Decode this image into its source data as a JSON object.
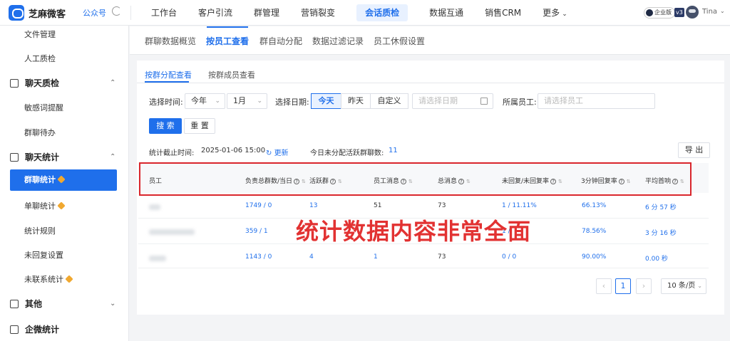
{
  "header": {
    "brand": "芝麻微客",
    "brand_sub": "公众号",
    "nav": [
      "工作台",
      "客户引流",
      "群管理",
      "营销裂变",
      "会话质检",
      "数据互通",
      "销售CRM",
      "更多"
    ],
    "nav_active_index": 4,
    "enterprise_badge": "企业版",
    "version_badge": "v3",
    "user_name": "Tina"
  },
  "sidebar": {
    "items": [
      {
        "label": "文件管理",
        "type": "item"
      },
      {
        "label": "人工质检",
        "type": "item"
      },
      {
        "label": "聊天质检",
        "type": "group"
      },
      {
        "label": "敏感词提醒",
        "type": "item"
      },
      {
        "label": "群聊待办",
        "type": "item"
      },
      {
        "label": "聊天统计",
        "type": "group"
      },
      {
        "label": "群聊统计",
        "type": "active"
      },
      {
        "label": "单聊统计",
        "type": "item"
      },
      {
        "label": "统计规则",
        "type": "item"
      },
      {
        "label": "未回复设置",
        "type": "item"
      },
      {
        "label": "未联系统计",
        "type": "item"
      },
      {
        "label": "其他",
        "type": "group"
      },
      {
        "label": "企微统计",
        "type": "group"
      }
    ]
  },
  "subtabs": [
    "群聊数据概览",
    "按员工查看",
    "群自动分配",
    "数据过滤记录",
    "员工休假设置"
  ],
  "subtab_active_index": 1,
  "inner_tabs": [
    "按群分配查看",
    "按群成员查看"
  ],
  "filters": {
    "time_label": "选择时间:",
    "year_value": "今年",
    "month_value": "1月",
    "date_label": "选择日期:",
    "date_options": [
      "今天",
      "昨天",
      "自定义"
    ],
    "date_active": "今天",
    "date_placeholder": "请选择日期",
    "staff_label": "所属员工:",
    "staff_placeholder": "请选择员工",
    "search_btn": "搜 索",
    "reset_btn": "重 置"
  },
  "stats": {
    "cutoff_label": "统计截止时间:",
    "cutoff_value": "2025-01-06 15:00",
    "refresh_label": "更新",
    "unassigned_label": "今日未分配活跃群聊数:",
    "unassigned_value": "11",
    "export_btn": "导 出"
  },
  "table": {
    "columns": [
      "员工",
      "负责总群数/当日",
      "活跃群",
      "员工消息",
      "总消息",
      "未回复/未回复率",
      "3分钟回复率",
      "平均首响"
    ],
    "rows": [
      [
        "1749 / 0",
        "13",
        "51",
        "73",
        "1 / 11.11%",
        "66.13%",
        "6 分 57 秒"
      ],
      [
        "359 / 1",
        "",
        "",
        "",
        "1 /",
        "78.56%",
        "3 分 16 秒"
      ],
      [
        "1143 / 0",
        "4",
        "1",
        "73",
        "0 / 0",
        "90.00%",
        "0.00 秒"
      ]
    ]
  },
  "overlay_text": "统计数据内容非常全面",
  "pagination": {
    "current": "1",
    "page_size": "10 条/页"
  },
  "colors": {
    "accent": "#1f6feb",
    "highlight": "#d9262c",
    "overlay": "#e23232"
  }
}
